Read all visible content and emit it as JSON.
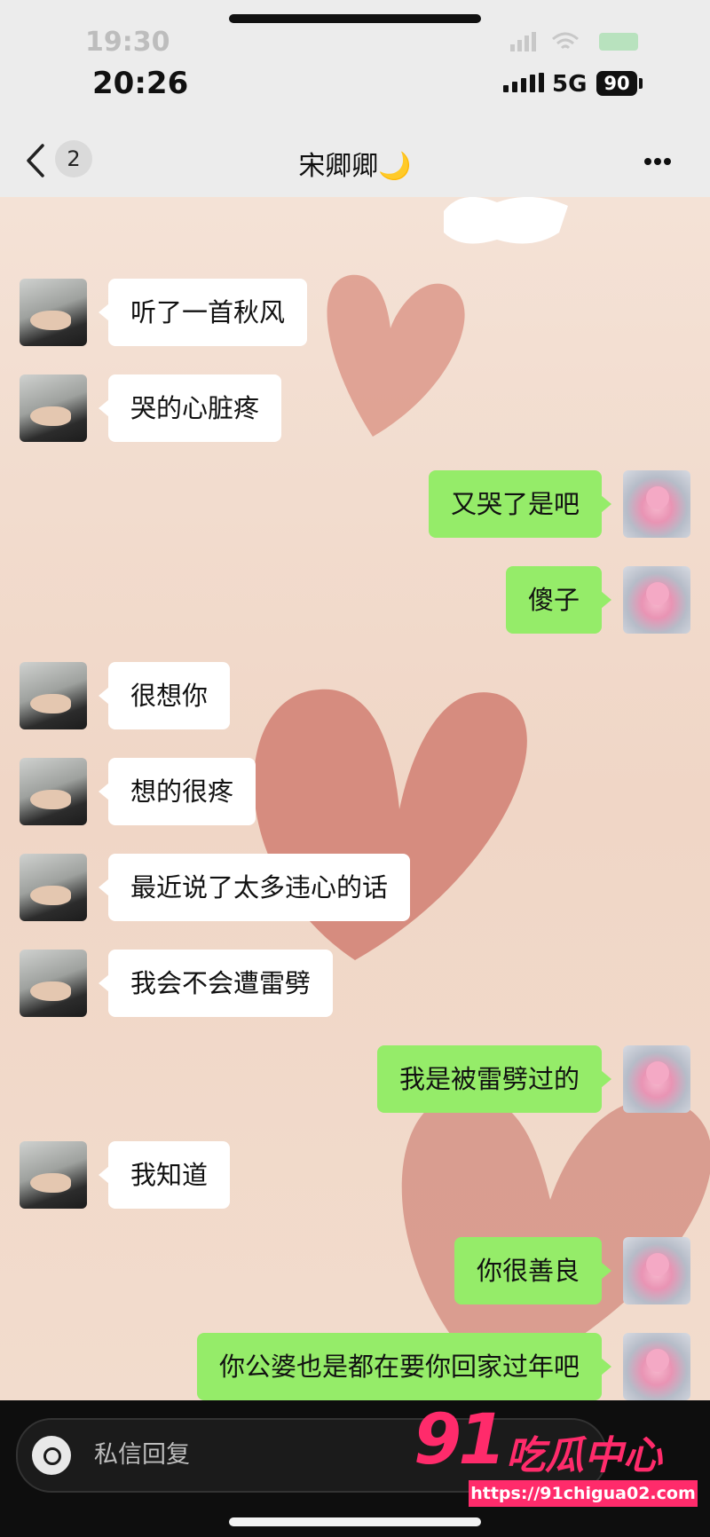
{
  "status_bar": {
    "ghost_time": "19:30",
    "time": "20:26",
    "network": "5G",
    "battery": "90"
  },
  "header": {
    "unread_count": "2",
    "title": "宋卿卿",
    "title_emoji": "🌙"
  },
  "messages": [
    {
      "side": "them",
      "text": "听了一首秋风"
    },
    {
      "side": "them",
      "text": "哭的心脏疼"
    },
    {
      "side": "me",
      "text": "又哭了是吧"
    },
    {
      "side": "me",
      "text": "傻子"
    },
    {
      "side": "them",
      "text": "很想你"
    },
    {
      "side": "them",
      "text": "想的很疼"
    },
    {
      "side": "them",
      "text": "最近说了太多违心的话"
    },
    {
      "side": "them",
      "text": "我会不会遭雷劈"
    },
    {
      "side": "me",
      "text": "我是被雷劈过的"
    },
    {
      "side": "them",
      "text": "我知道"
    },
    {
      "side": "me",
      "text": "你很善良"
    },
    {
      "side": "me",
      "text": "你公婆也是都在要你回家过年吧"
    }
  ],
  "input": {
    "placeholder": "私信回复"
  },
  "watermark": {
    "number": "91",
    "name": "吃瓜中心",
    "url": "https://91chigua02.com"
  },
  "colors": {
    "my_bubble": "#95ec69",
    "their_bubble": "#ffffff",
    "wallpaper": "#f2d9cb",
    "watermark": "#ff2b6b"
  }
}
